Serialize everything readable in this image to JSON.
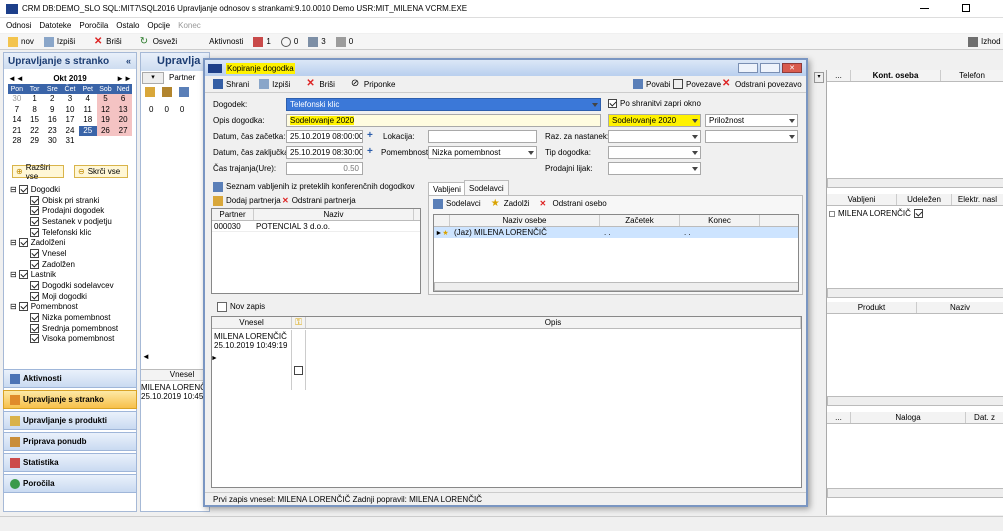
{
  "titlebar": {
    "text": "CRM  DB:DEMO_SLO  SQL:MIT7\\SQL2016  Upravljanje odnosov s strankami:9.10.0010  Demo  USR:MIT_MILENA  VCRM.EXE"
  },
  "menubar": [
    "Odnosi",
    "Datoteke",
    "Poročila",
    "Ostalo",
    "Opcije",
    "Konec"
  ],
  "toolbar": {
    "new": "nov",
    "print": "Izpiši",
    "delete": "Briši",
    "refresh": "Osveži",
    "activities": "Aktivnosti",
    "count1": "1",
    "count2": "0",
    "count3": "3",
    "count4": "0",
    "exit": "Izhod"
  },
  "left_panel": {
    "title": "Upravljanje s stranko",
    "calendar": {
      "month": "Okt 2019",
      "days": [
        "Pon",
        "Tor",
        "Sre",
        "Čet",
        "Pet",
        "Sob",
        "Ned"
      ],
      "weeks": [
        [
          "30",
          "1",
          "2",
          "3",
          "4",
          "5",
          "6"
        ],
        [
          "7",
          "8",
          "9",
          "10",
          "11",
          "12",
          "13"
        ],
        [
          "14",
          "15",
          "16",
          "17",
          "18",
          "19",
          "20"
        ],
        [
          "21",
          "22",
          "23",
          "24",
          "25",
          "26",
          "27"
        ],
        [
          "28",
          "29",
          "30",
          "31",
          "",
          "",
          ""
        ]
      ],
      "selected": "25"
    },
    "expand": "Razširi vse",
    "collapse": "Skrči vse",
    "tree": [
      {
        "label": "Dogodki",
        "level": 0
      },
      {
        "label": "Obisk pri stranki",
        "level": 1
      },
      {
        "label": "Prodajni dogodek",
        "level": 1
      },
      {
        "label": "Sestanek v podjetju",
        "level": 1
      },
      {
        "label": "Telefonski klic",
        "level": 1
      },
      {
        "label": "Zadolženi",
        "level": 0
      },
      {
        "label": "Vnesel",
        "level": 1
      },
      {
        "label": "Zadolžen",
        "level": 1
      },
      {
        "label": "Lastnik",
        "level": 0
      },
      {
        "label": "Dogodki sodelavcev",
        "level": 1
      },
      {
        "label": "Moji dogodki",
        "level": 1
      },
      {
        "label": "Pomembnost",
        "level": 0
      },
      {
        "label": "Nizka pomembnost",
        "level": 1
      },
      {
        "label": "Srednja pomembnost",
        "level": 1
      },
      {
        "label": "Visoka pomembnost",
        "level": 1
      }
    ],
    "nav": [
      "Aktivnosti",
      "Upravljanje s stranko",
      "Upravljanje s produkti",
      "Priprava ponudb",
      "Statistika",
      "Poročila"
    ]
  },
  "middle_panel": {
    "title": "Upravlja",
    "partner_tab": "Partner",
    "zeros": [
      "0",
      "0",
      "0"
    ],
    "col_vnesel": "Vnesel",
    "row_name": "MILENA LORENČI",
    "row_date": "25.10.2019 10:45:3"
  },
  "right_panel": {
    "top_cols": [
      "...",
      "Kont. oseba",
      "Telefon"
    ],
    "mid_cols": [
      "Vabljeni",
      "Udeležen",
      "Elektr. nasl"
    ],
    "mid_row": "MILENA LORENČIČ",
    "prod_cols": [
      "Produkt",
      "Naziv"
    ],
    "bottom_cols": [
      "...",
      "Naloga",
      "Dat. z"
    ]
  },
  "dialog": {
    "title": "Kopiranje dogodka",
    "toolbar": {
      "save": "Shrani",
      "print": "Izpiši",
      "delete": "Briši",
      "attachments": "Priponke"
    },
    "toolbar_right": {
      "invite": "Povabi",
      "links": "Povezave",
      "remove_link": "Odstrani povezavo"
    },
    "labels": {
      "event": "Dogodek:",
      "description": "Opis dogodka:",
      "start": "Datum, čas začetka:",
      "end": "Datum, čas zaključka:",
      "duration": "Čas trajanja(Ure):",
      "location": "Lokacija:",
      "importance": "Pomembnost:",
      "reason": "Raz. za nastanek:",
      "type": "Tip dogodka:",
      "sales": "Prodajni lijak:",
      "close_after_save": "Po shranitvi zapri okno"
    },
    "values": {
      "event": "Telefonski klic",
      "description": "Sodelovanje 2020",
      "start": "25.10.2019 08:00:00",
      "end": "25.10.2019 08:30:00",
      "duration": "0.50",
      "location": "",
      "importance": "Nizka pomembnost",
      "project": "Sodelovanje 2020",
      "opportunity": "Priložnost"
    },
    "invited_label": "Seznam vabljenih iz preteklih konferenčnih dogodkov",
    "add_partner": "Dodaj partnerja",
    "remove_partner": "Odstrani partnerja",
    "partner_cols": [
      "Partner",
      "Naziv"
    ],
    "partner_row": {
      "code": "000030",
      "name": "POTENCIAL 3 d.o.o."
    },
    "tabs": [
      "Vabljeni",
      "Sodelavci"
    ],
    "cow_toolbar": {
      "coworkers": "Sodelavci",
      "assign": "Zadolži",
      "remove": "Odstrani osebo"
    },
    "cow_cols": [
      "Naziv osebe",
      "Začetek",
      "Konec"
    ],
    "cow_row": {
      "name": "(Jaz) MILENA LORENČIČ",
      "start": ". .",
      "end": ". ."
    },
    "new_entry": "Nov zapis",
    "notes_cols": [
      "Vnesel",
      "Opis"
    ],
    "note_row": {
      "name": "MILENA LORENČIČ",
      "date": "25.10.2019 10:49:19"
    },
    "status": "Prvi zapis vnesel: MILENA LORENČIČ Zadnji popravil: MILENA LORENČIČ"
  },
  "colors": {
    "highlight": "#fff200",
    "selected_blue": "#3b78d8",
    "dialog_border": "#7a96c2"
  }
}
